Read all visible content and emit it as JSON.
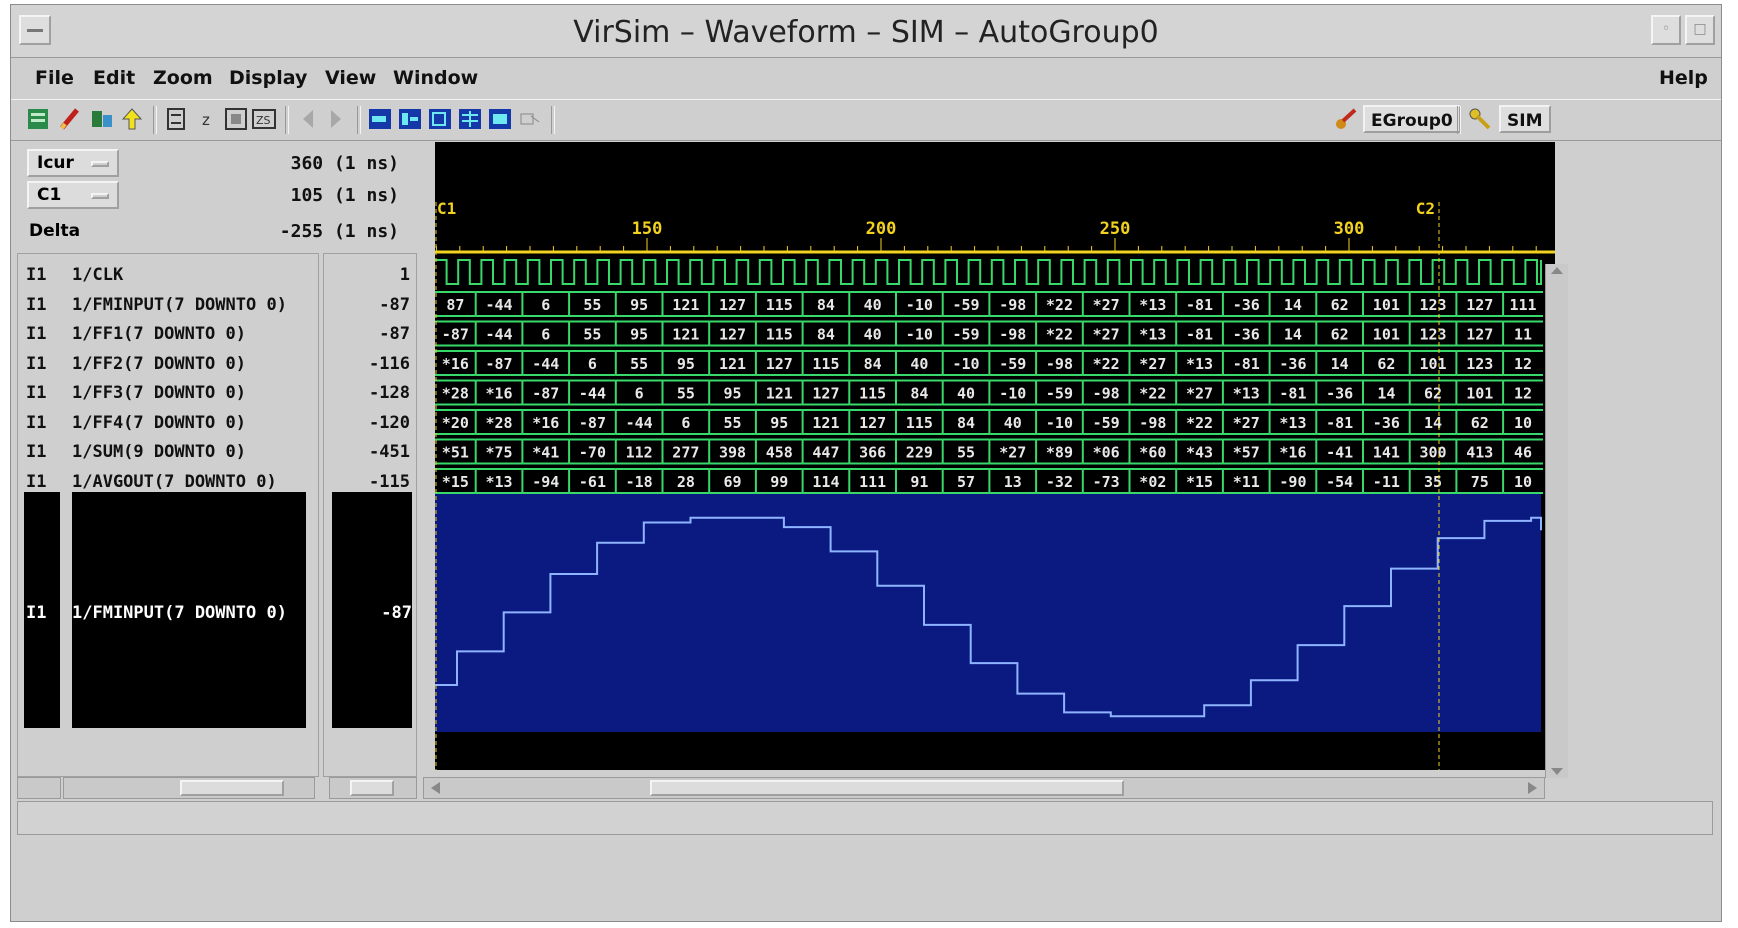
{
  "window": {
    "title": "VirSim – Waveform – SIM – AutoGroup0"
  },
  "menu": [
    "File",
    "Edit",
    "Zoom",
    "Display",
    "View",
    "Window"
  ],
  "help_label": "Help",
  "toolbar": {
    "group_label": "EGroup0",
    "sim_label": "SIM"
  },
  "cursors": [
    {
      "name": "Icur",
      "value": "360 (1 ns)"
    },
    {
      "name": "C1",
      "value": "105 (1 ns)"
    }
  ],
  "delta": {
    "label": "Delta",
    "value": "-255 (1 ns)"
  },
  "ruler": {
    "c1_label": "C1",
    "c2_label": "C2",
    "ticks": [
      {
        "label": "150",
        "time": 150
      },
      {
        "label": "200",
        "time": 200
      },
      {
        "label": "250",
        "time": 250
      },
      {
        "label": "300",
        "time": 300
      }
    ]
  },
  "signals": [
    {
      "prefix": "I1",
      "name": "1/CLK",
      "value": "1",
      "cells": []
    },
    {
      "prefix": "I1",
      "name": "1/FMINPUT(7 DOWNTO 0)",
      "value": "-87",
      "cells": [
        "87",
        "-44",
        "6",
        "55",
        "95",
        "121",
        "127",
        "115",
        "84",
        "40",
        "-10",
        "-59",
        "-98",
        "*22",
        "*27",
        "*13",
        "-81",
        "-36",
        "14",
        "62",
        "101",
        "123",
        "127",
        "111"
      ]
    },
    {
      "prefix": "I1",
      "name": "1/FF1(7 DOWNTO 0)",
      "value": "-87",
      "cells": [
        "-87",
        "-44",
        "6",
        "55",
        "95",
        "121",
        "127",
        "115",
        "84",
        "40",
        "-10",
        "-59",
        "-98",
        "*22",
        "*27",
        "*13",
        "-81",
        "-36",
        "14",
        "62",
        "101",
        "123",
        "127",
        "11"
      ]
    },
    {
      "prefix": "I1",
      "name": "1/FF2(7 DOWNTO 0)",
      "value": "-116",
      "cells": [
        "*16",
        "-87",
        "-44",
        "6",
        "55",
        "95",
        "121",
        "127",
        "115",
        "84",
        "40",
        "-10",
        "-59",
        "-98",
        "*22",
        "*27",
        "*13",
        "-81",
        "-36",
        "14",
        "62",
        "101",
        "123",
        "12"
      ]
    },
    {
      "prefix": "I1",
      "name": "1/FF3(7 DOWNTO 0)",
      "value": "-128",
      "cells": [
        "*28",
        "*16",
        "-87",
        "-44",
        "6",
        "55",
        "95",
        "121",
        "127",
        "115",
        "84",
        "40",
        "-10",
        "-59",
        "-98",
        "*22",
        "*27",
        "*13",
        "-81",
        "-36",
        "14",
        "62",
        "101",
        "12"
      ]
    },
    {
      "prefix": "I1",
      "name": "1/FF4(7 DOWNTO 0)",
      "value": "-120",
      "cells": [
        "*20",
        "*28",
        "*16",
        "-87",
        "-44",
        "6",
        "55",
        "95",
        "121",
        "127",
        "115",
        "84",
        "40",
        "-10",
        "-59",
        "-98",
        "*22",
        "*27",
        "*13",
        "-81",
        "-36",
        "14",
        "62",
        "10"
      ]
    },
    {
      "prefix": "I1",
      "name": "1/SUM(9 DOWNTO 0)",
      "value": "-451",
      "cells": [
        "*51",
        "*75",
        "*41",
        "-70",
        "112",
        "277",
        "398",
        "458",
        "447",
        "366",
        "229",
        "55",
        "*27",
        "*89",
        "*06",
        "*60",
        "*43",
        "*57",
        "*16",
        "-41",
        "141",
        "300",
        "413",
        "46"
      ]
    },
    {
      "prefix": "I1",
      "name": "1/AVGOUT(7 DOWNTO 0)",
      "value": "-115",
      "cells": [
        "*15",
        "*13",
        "-94",
        "-61",
        "-18",
        "28",
        "69",
        "99",
        "114",
        "111",
        "91",
        "57",
        "13",
        "-32",
        "-73",
        "*02",
        "*15",
        "*11",
        "-90",
        "-54",
        "-11",
        "35",
        "75",
        "10"
      ]
    }
  ],
  "analog": {
    "prefix": "I1",
    "name": "1/FMINPUT(7 DOWNTO 0)",
    "value": "-87",
    "values": [
      -87,
      -44,
      6,
      55,
      95,
      121,
      127,
      127,
      115,
      84,
      40,
      -10,
      -59,
      -98,
      -122,
      -127,
      -127,
      -113,
      -81,
      -36,
      14,
      62,
      101,
      123,
      127,
      127,
      111
    ]
  },
  "colors": {
    "wave_bg": "#000000",
    "analog_bg": "#0a1a80",
    "trace_green": "#39d86a",
    "trace_white": "#e8e8e8",
    "ruler_yellow": "#f2d21e",
    "analog_line": "#8fb4ff"
  }
}
